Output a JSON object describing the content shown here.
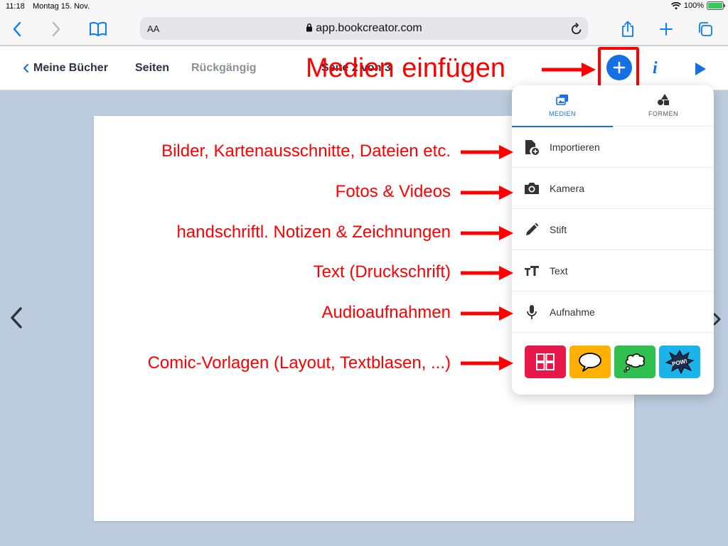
{
  "status_bar": {
    "time": "11:18",
    "date": "Montag 15. Nov.",
    "battery": "100%"
  },
  "browser": {
    "aa_label": "AA",
    "url": "app.bookcreator.com"
  },
  "appbar": {
    "back_label": "Meine Bücher",
    "pages_label": "Seiten",
    "undo_label": "Rückgängig",
    "page_title": "Seite 2 von 3",
    "info_label": "i"
  },
  "panel": {
    "tabs": [
      {
        "label": "MEDIEN"
      },
      {
        "label": "FORMEN"
      }
    ],
    "items": [
      {
        "label": "Importieren",
        "icon": "import-file-icon"
      },
      {
        "label": "Kamera",
        "icon": "camera-icon"
      },
      {
        "label": "Stift",
        "icon": "pen-icon"
      },
      {
        "label": "Text",
        "icon": "text-icon"
      },
      {
        "label": "Aufnahme",
        "icon": "microphone-icon"
      }
    ],
    "comics": [
      {
        "name": "comic-layout",
        "color": "#e8174a"
      },
      {
        "name": "speech-bubble",
        "color": "#ffb000"
      },
      {
        "name": "thought-bubble",
        "color": "#2fbf4f"
      },
      {
        "name": "pow-sticker",
        "color": "#1ab4ea"
      }
    ],
    "pow_text": "POW!"
  },
  "annotations": {
    "title": "Medien einfügen",
    "import": "Bilder, Kartenausschnitte, Dateien etc.",
    "camera": "Fotos & Videos",
    "pen": "handschriftl. Notizen & Zeichnungen",
    "text": "Text (Druckschrift)",
    "audio": "Audioaufnahmen",
    "comics": "Comic-Vorlagen (Layout, Textblasen, ...)",
    "color": "#ff0000"
  },
  "colors": {
    "accent": "#1670e4",
    "background": "#bccbdd"
  }
}
